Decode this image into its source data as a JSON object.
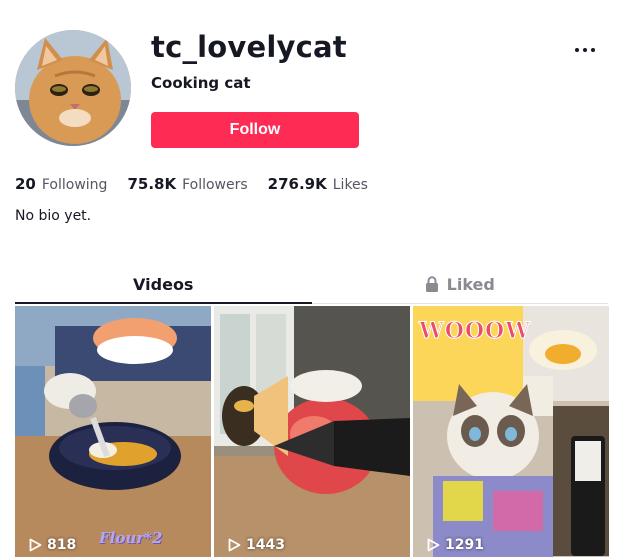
{
  "profile": {
    "username": "tc_lovelycat",
    "nickname": "Cooking cat",
    "follow_label": "Follow",
    "bio": "No bio yet."
  },
  "stats": [
    {
      "value": "20",
      "label": "Following"
    },
    {
      "value": "75.8K",
      "label": "Followers"
    },
    {
      "value": "276.9K",
      "label": "Likes"
    }
  ],
  "tabs": {
    "videos": "Videos",
    "liked": "Liked"
  },
  "videos": [
    {
      "views": "818",
      "overlay": "Flour*2"
    },
    {
      "views": "1443",
      "overlay": ""
    },
    {
      "views": "1291",
      "overlay": "WOOOW"
    }
  ],
  "colors": {
    "accent": "#fe2c55",
    "text": "#161823",
    "muted": "#545661"
  },
  "icons": [
    "more-icon",
    "lock-icon",
    "play-icon"
  ]
}
